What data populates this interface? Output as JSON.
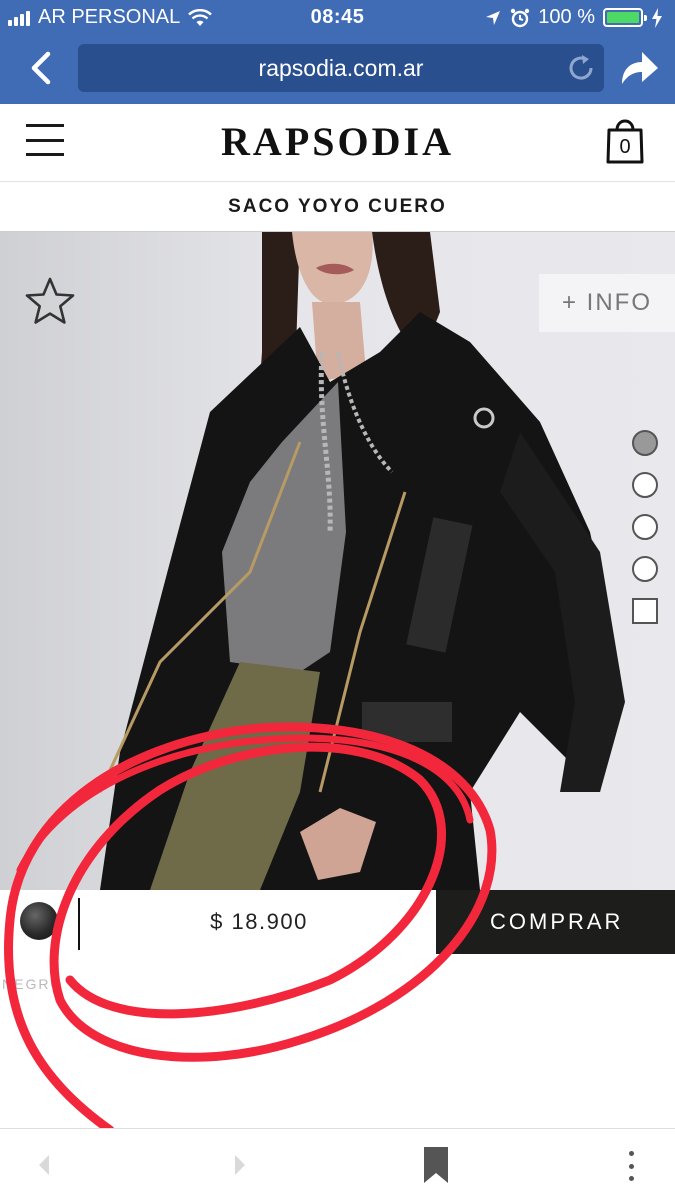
{
  "status_bar": {
    "carrier": "AR PERSONAL",
    "time": "08:45",
    "battery": "100 %"
  },
  "browser": {
    "url": "rapsodia.com.ar"
  },
  "site": {
    "logo": "RAPSODIA",
    "cart_count": "0"
  },
  "product": {
    "title": "SACO YOYO CUERO",
    "info_label": "+ INFO",
    "price": "$ 18.900",
    "buy_label": "COMPRAR",
    "color_name": "NEGRO"
  },
  "icons": {
    "menu": "hamburger-menu-icon",
    "cart": "shopping-bag-icon",
    "favorite": "star-outline-icon",
    "back": "chevron-left-icon",
    "forward": "chevron-right-icon",
    "share": "share-arrow-icon",
    "reload": "reload-icon",
    "bookmark": "bookmark-icon",
    "more": "more-vertical-icon"
  },
  "colors": {
    "browser_bar": "#3f6cb5",
    "url_field": "#2a4f8e",
    "buy_button": "#1d1d1b",
    "annotation": "#f2273b"
  }
}
